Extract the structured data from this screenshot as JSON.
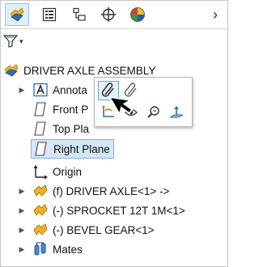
{
  "panel": {
    "tabs": [
      {
        "icon": "feature-manager-icon",
        "active": true
      },
      {
        "icon": "property-manager-icon",
        "active": false
      },
      {
        "icon": "configuration-manager-icon",
        "active": false
      },
      {
        "icon": "dimxpert-manager-icon",
        "active": false
      },
      {
        "icon": "display-manager-icon",
        "active": false
      }
    ],
    "more_icon": "chevron-right-icon",
    "more_glyph": "›",
    "filter_icon": "filter-icon",
    "filter_glyph": "▾"
  },
  "tree": {
    "root": {
      "label": "DRIVER AXLE ASSEMBLY",
      "icon": "assembly-icon"
    },
    "items": [
      {
        "label": "Annota",
        "icon": "annotations-icon",
        "expand": "▶"
      },
      {
        "label": "Front P",
        "icon": "plane-icon"
      },
      {
        "label": "Top Pla",
        "icon": "plane-icon"
      },
      {
        "label": "Right Plane",
        "icon": "plane-icon",
        "selected": true
      },
      {
        "label": "Origin",
        "icon": "origin-icon"
      },
      {
        "label": "(f) DRIVER AXLE<1> ->",
        "icon": "part-icon",
        "expand": "▶"
      },
      {
        "label": "(-) SPROCKET 12T 1M<1>",
        "icon": "part-icon",
        "expand": "▶"
      },
      {
        "label": "(-) BEVEL GEAR<1>",
        "icon": "part-icon",
        "expand": "▶"
      },
      {
        "label": "Mates",
        "icon": "mates-icon",
        "expand": "▶"
      }
    ]
  },
  "context_toolbar": {
    "buttons": [
      {
        "icon": "paperclip-icon",
        "hot": true
      },
      {
        "icon": "paperclip-alt-icon",
        "hot": false
      },
      {
        "icon": "sketch-icon",
        "hot": false
      },
      {
        "icon": "hide-icon",
        "hot": false
      },
      {
        "icon": "zoom-to-selection-icon",
        "hot": false
      },
      {
        "icon": "normal-to-icon",
        "hot": false
      }
    ]
  },
  "colors": {
    "selection_bg": "#d4e6f8",
    "selection_border": "#7fb1e3",
    "part_yellow": "#f2b01e",
    "accent_blue": "#2a6fb8"
  }
}
